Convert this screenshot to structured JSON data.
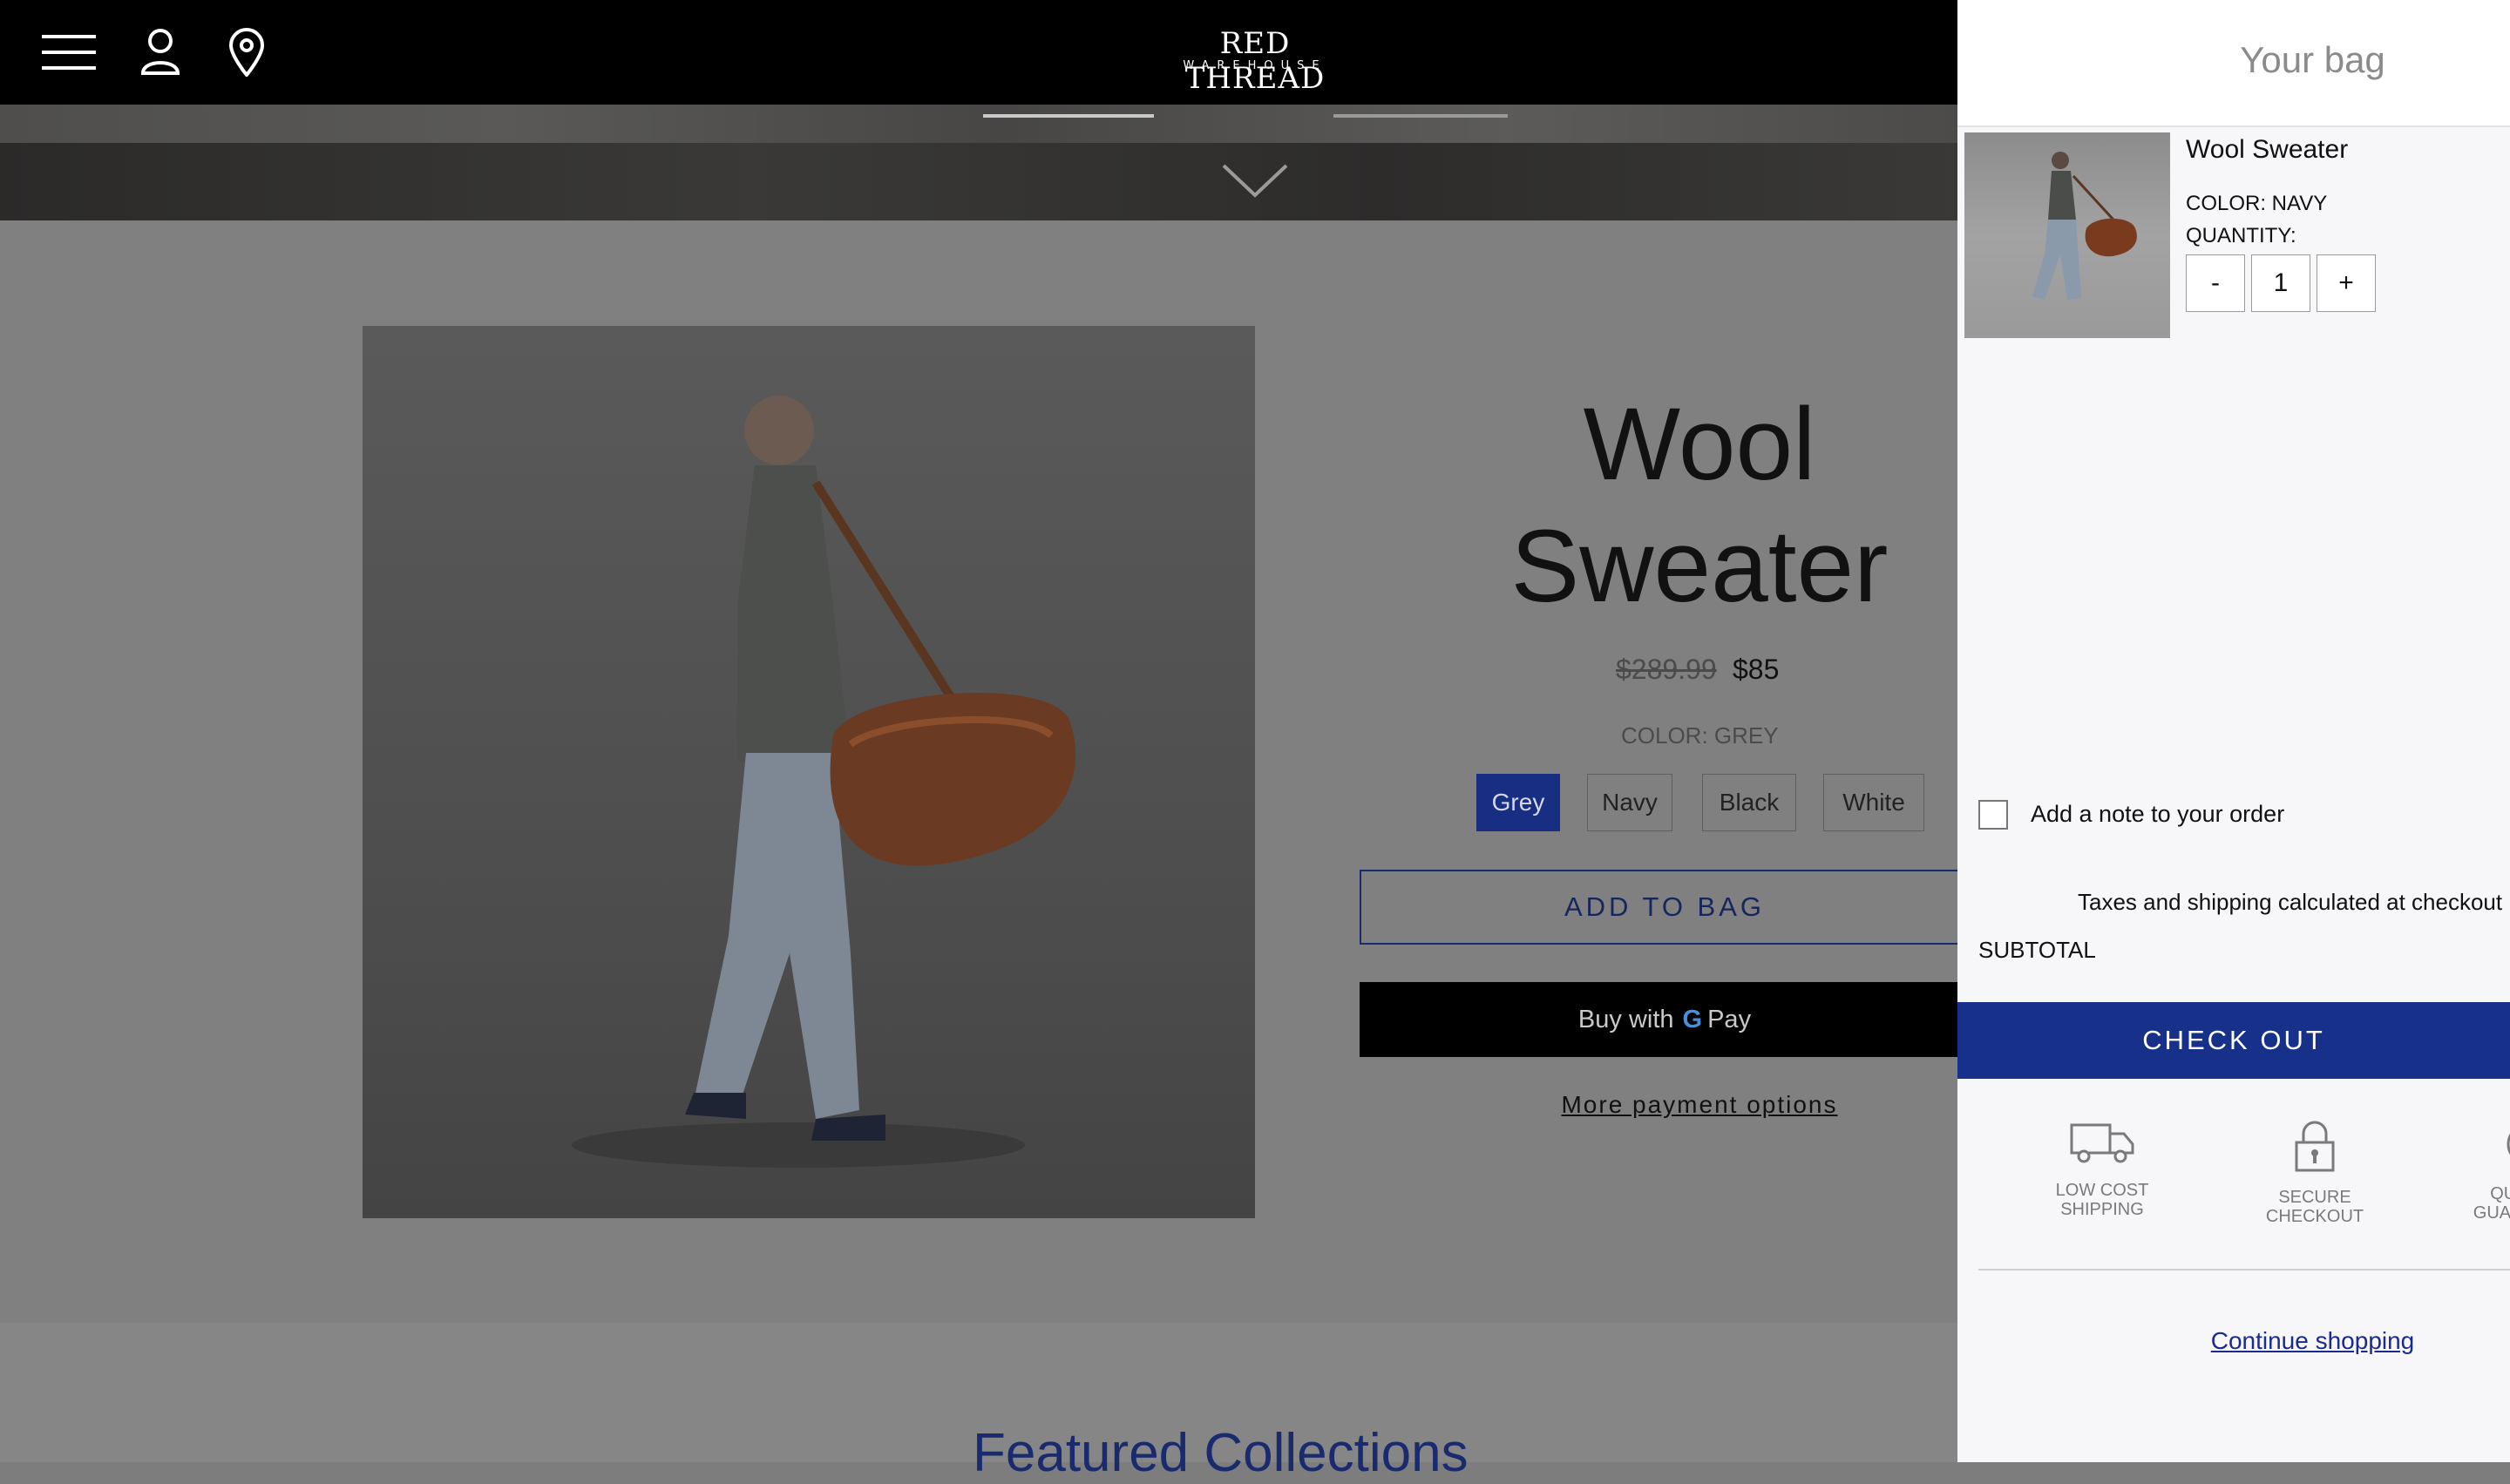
{
  "header": {
    "logo_main": "RED THREAD",
    "logo_sub": "WAREHOUSE"
  },
  "product": {
    "title_line1": "Wool",
    "title_line2": "Sweater",
    "price_old": "$289.99",
    "price_new": "$85",
    "color_label": "COLOR: GREY",
    "swatches": [
      "Grey",
      "Navy",
      "Black",
      "White"
    ],
    "selected_swatch": "Grey",
    "add_to_bag": "ADD TO BAG",
    "gpay_prefix": "Buy with",
    "gpay_g": "G",
    "gpay_suffix": "Pay",
    "more_payment": "More payment options"
  },
  "featured": {
    "heading": "Featured Collections"
  },
  "cart": {
    "title": "Your bag",
    "item": {
      "name": "Wool Sweater",
      "color": "COLOR: NAVY",
      "quantity_label": "QUANTITY:",
      "minus": "-",
      "quantity": "1",
      "plus": "+"
    },
    "note_label": "Add a note to your order",
    "taxes_text": "Taxes and shipping calculated at checkout",
    "subtotal_label": "SUBTOTAL",
    "checkout": "CHECK OUT",
    "badges": [
      {
        "icon": "truck-icon",
        "label_line1": "LOW COST",
        "label_line2": "SHIPPING"
      },
      {
        "icon": "lock-icon",
        "label_line1": "SECURE",
        "label_line2": "CHECKOUT"
      },
      {
        "icon": "quality-icon",
        "label_line1": "QUALITY",
        "label_line2": "GUARANTEE"
      }
    ],
    "continue_shopping": "Continue shopping"
  },
  "colors": {
    "accent_blue": "#17318a",
    "header_bg": "#000000",
    "overlay_gray": "#808080"
  }
}
